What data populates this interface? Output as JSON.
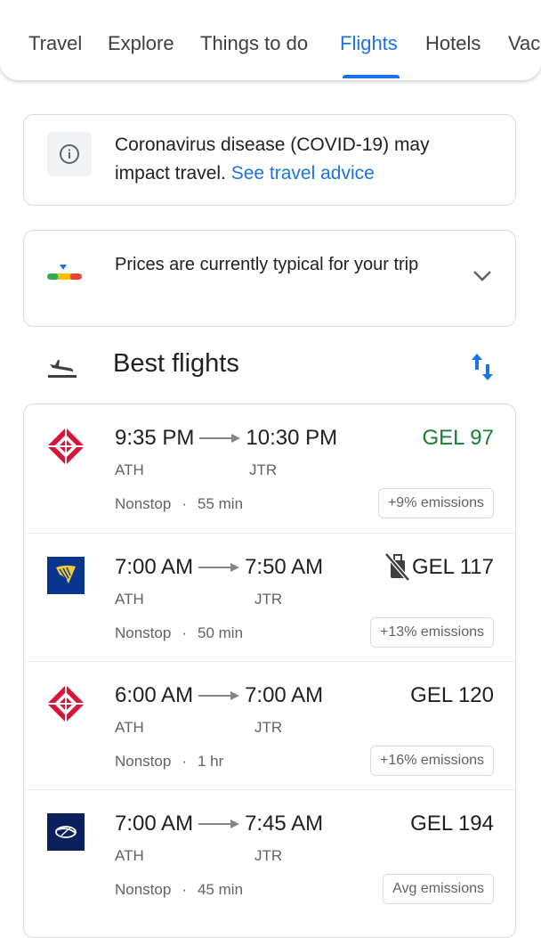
{
  "tabs": [
    {
      "label": "Travel"
    },
    {
      "label": "Explore"
    },
    {
      "label": "Things to do"
    },
    {
      "label": "Flights"
    },
    {
      "label": "Hotels"
    },
    {
      "label": "Vac"
    }
  ],
  "covid": {
    "text": "Coronavirus disease (COVID-19) may impact travel.",
    "link": "See travel advice"
  },
  "price_insight": {
    "text": "Prices are currently typical for your trip"
  },
  "best_flights": {
    "title": "Best flights"
  },
  "flights": [
    {
      "airline_icon": "olympic-rings-logo",
      "dep_time": "9:35 PM",
      "arr_time": "10:30 PM",
      "dep_airport": "ATH",
      "arr_airport": "JTR",
      "stops": "Nonstop",
      "duration": "55 min",
      "price": "GEL 97",
      "emissions": "+9% emissions",
      "price_color": "#188038"
    },
    {
      "airline_icon": "harp-logo",
      "dep_time": "7:00 AM",
      "arr_time": "7:50 AM",
      "dep_airport": "ATH",
      "arr_airport": "JTR",
      "stops": "Nonstop",
      "duration": "50 min",
      "price": "GEL 117",
      "emissions": "+13% emissions",
      "no_bag_icon": "no-carry-on-icon"
    },
    {
      "airline_icon": "olympic-rings-logo",
      "dep_time": "6:00 AM",
      "arr_time": "7:00 AM",
      "dep_airport": "ATH",
      "arr_airport": "JTR",
      "stops": "Nonstop",
      "duration": "1 hr",
      "price": "GEL 120",
      "emissions": "+16% emissions"
    },
    {
      "airline_icon": "bird-logo",
      "dep_time": "7:00 AM",
      "arr_time": "7:45 AM",
      "dep_airport": "ATH",
      "arr_airport": "JTR",
      "stops": "Nonstop",
      "duration": "45 min",
      "price": "GEL 194",
      "emissions": "Avg emissions"
    }
  ],
  "colors": {
    "accent": "#1a73e8",
    "good_price": "#188038"
  }
}
